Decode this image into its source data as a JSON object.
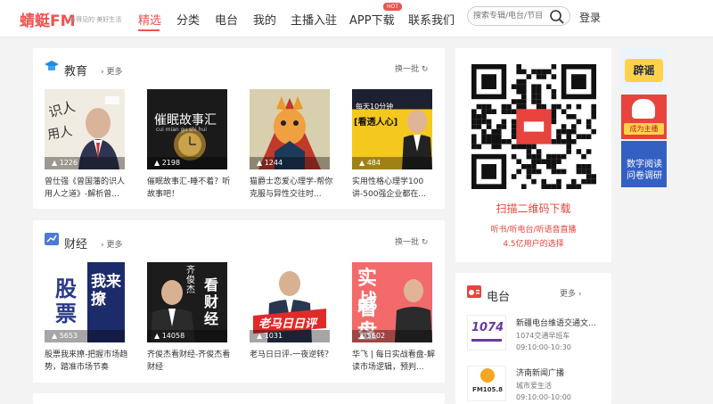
{
  "header": {
    "logo": "蜻蜓FM",
    "slogan": "听得见的   美好生活",
    "nav": [
      "精选",
      "分类",
      "电台",
      "我的",
      "主播入驻",
      "APP下载",
      "联系我们"
    ],
    "hot_badge": "HOT",
    "search_placeholder": "搜索专辑/电台/节目",
    "login": "登录"
  },
  "education": {
    "title": "教育",
    "more": "更多",
    "swap": "换一批",
    "items": [
      {
        "count": "1226",
        "caption": "曾仕强《曾国藩的识人用人之道》-解析曾..."
      },
      {
        "count": "2198",
        "caption": "催眠故事汇-睡不着？听故事吧！",
        "cover_title": "催眠故事汇",
        "cover_sub": "cui mian gu shi hui"
      },
      {
        "count": "1244",
        "caption": "猫爵士恋爱心理学-帮你克服与异性交往时..."
      },
      {
        "count": "484",
        "caption": "实用性格心理学100讲-500强企业都在...",
        "cover_top": "每天10分钟",
        "cover_title": "[看透人心]"
      }
    ]
  },
  "finance": {
    "title": "财经",
    "more": "更多",
    "swap": "换一批",
    "items": [
      {
        "count": "5653",
        "caption": "股票我来撩-把握市场趋势，踏准市场节奏",
        "cover_a": "股票",
        "cover_b": "我来撩"
      },
      {
        "count": "14058",
        "caption": "齐俊杰看财经-齐俊杰看财经",
        "cover_a": "齐俊杰",
        "cover_b": "看财经"
      },
      {
        "count": "1031",
        "caption": "老马日日评-一夜逆转？",
        "cover_a": "老马日日评"
      },
      {
        "count": "5602",
        "caption": "华飞 | 每日实战看盘-解读市场逻辑，预判...",
        "cover_a": "实战",
        "cover_b": "看盘"
      }
    ]
  },
  "qr": {
    "label": "扫描二维码下载",
    "sub1": "听书/听电台/听语音直播",
    "sub2": "4.5亿用户的选择"
  },
  "radio": {
    "title": "电台",
    "more": "更多",
    "items": [
      {
        "name": "新疆电台维语交通文...",
        "show": "1074交通早班车",
        "time": "09:10:00-10:30",
        "logo": "1074"
      },
      {
        "name": "济南新闻广播",
        "show": "城市爱生活",
        "time": "09:10:00-10:00",
        "logo": "FM105.8"
      }
    ]
  },
  "sidebar": {
    "items": [
      "辟谣",
      "成为主播",
      "数字阅读问卷调研"
    ]
  },
  "colors": {
    "brand": "#f0524f",
    "accent": "#e8433c"
  }
}
